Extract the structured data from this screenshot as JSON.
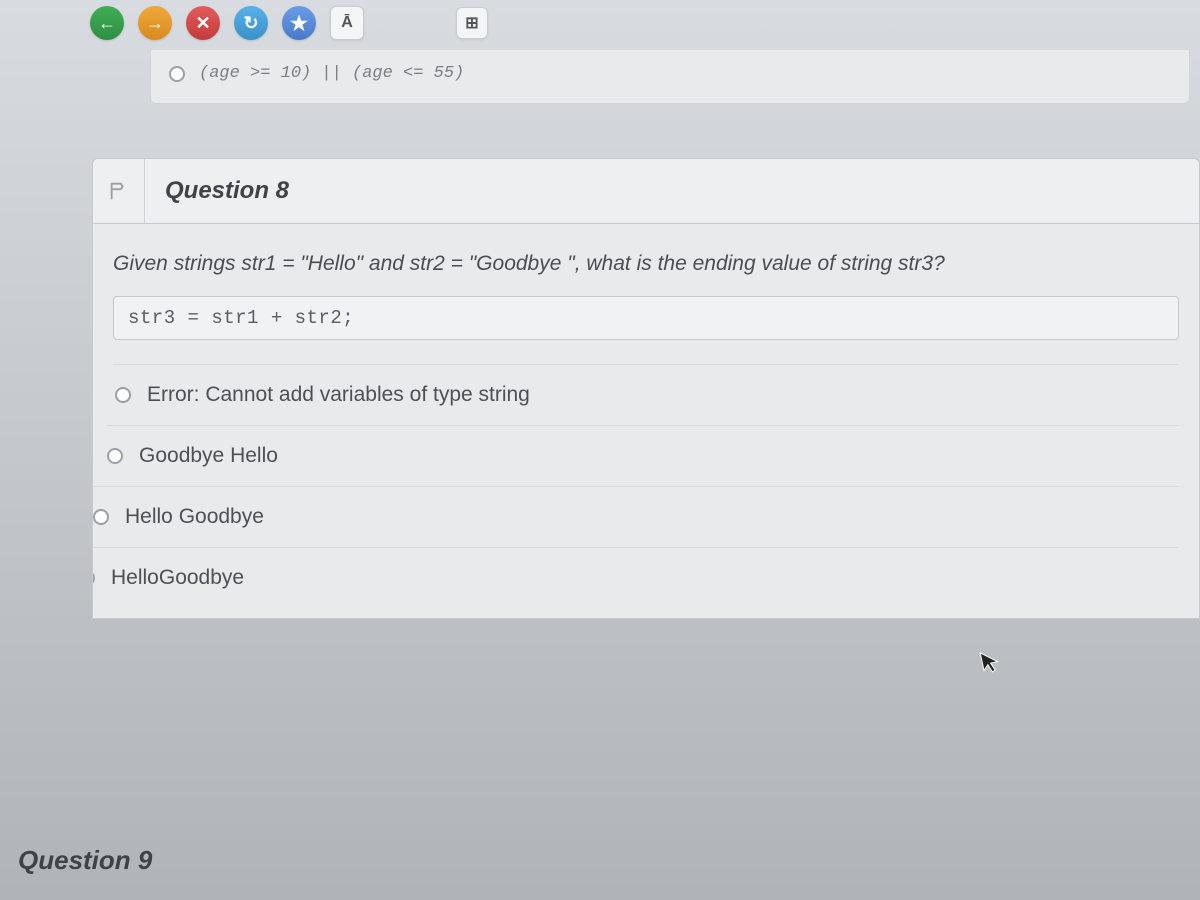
{
  "toolbar": {
    "back_icon": "←",
    "forward_icon": "→",
    "close_icon": "✕",
    "refresh_icon": "↻",
    "star_icon": "★",
    "letter_a": "Ā",
    "grid_icon": "⊞"
  },
  "previous_question": {
    "last_option": "(age >= 10) || (age <= 55)"
  },
  "question8": {
    "title": "Question 8",
    "prompt": "Given strings str1 = \"Hello\" and str2 = \"Goodbye \", what is the ending value of string str3?",
    "code": "str3 = str1 + str2;",
    "options": [
      "Error: Cannot add variables of type string",
      "Goodbye Hello",
      "Hello Goodbye",
      "HelloGoodbye"
    ],
    "flag_icon": "⚑"
  },
  "question9": {
    "title": "Question 9"
  },
  "cursor_glyph": "➤"
}
